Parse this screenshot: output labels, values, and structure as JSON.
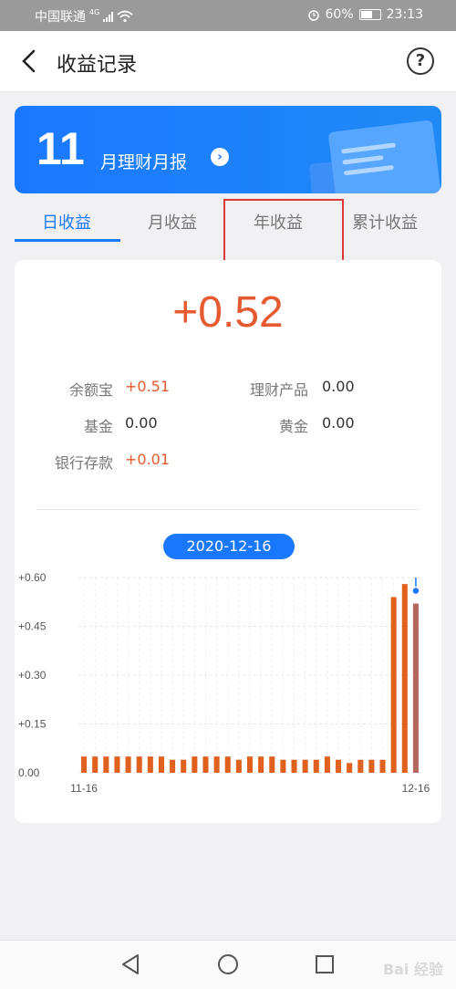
{
  "status_bar": {
    "carrier": "中国联通",
    "network": "4G",
    "battery": "60%",
    "time": "23:13"
  },
  "header": {
    "title": "收益记录"
  },
  "banner": {
    "day": "11",
    "label": "月理财月报"
  },
  "tabs": [
    {
      "label": "日收益",
      "active": true
    },
    {
      "label": "月收益",
      "active": false
    },
    {
      "label": "年收益",
      "active": false
    },
    {
      "label": "累计收益",
      "active": false
    }
  ],
  "summary": {
    "total": "+0.52",
    "items": [
      {
        "label": "余额宝",
        "value": "+0.51",
        "highlight": true
      },
      {
        "label": "理财产品",
        "value": "0.00",
        "highlight": false
      },
      {
        "label": "基金",
        "value": "0.00",
        "highlight": false
      },
      {
        "label": "黄金",
        "value": "0.00",
        "highlight": false
      },
      {
        "label": "银行存款",
        "value": "+0.01",
        "highlight": true
      }
    ]
  },
  "selected_date": "2020-12-16",
  "chart_data": {
    "type": "bar",
    "ylim": [
      0,
      0.6
    ],
    "yticks": [
      "+0.60",
      "+0.45",
      "+0.30",
      "+0.15",
      "0.00"
    ],
    "ytick_values": [
      0.6,
      0.45,
      0.3,
      0.15,
      0.0
    ],
    "xlabels": [
      {
        "index": 0,
        "label": "11-16"
      },
      {
        "index": 30,
        "label": "12-16"
      }
    ],
    "values": [
      0.05,
      0.05,
      0.05,
      0.05,
      0.05,
      0.05,
      0.05,
      0.05,
      0.04,
      0.04,
      0.05,
      0.05,
      0.05,
      0.05,
      0.04,
      0.05,
      0.05,
      0.05,
      0.04,
      0.04,
      0.04,
      0.04,
      0.05,
      0.04,
      0.03,
      0.04,
      0.04,
      0.04,
      0.54,
      0.58,
      0.52
    ],
    "selected_index": 30,
    "bar_color": "#e0611e",
    "selected_color": "#b5675c",
    "marker_color": "#1a78ff"
  },
  "watermark": "Bai 经验"
}
